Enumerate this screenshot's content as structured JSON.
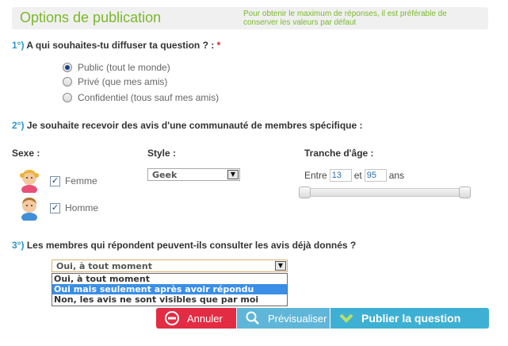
{
  "header": {
    "title": "Options de publication",
    "hint": "Pour obtenir le maximum de réponses, il est préférable de conserver les valeurs par défaut"
  },
  "q1": {
    "num": "1°)",
    "text": "A qui souhaites-tu diffuser ta question ? :",
    "required": "*",
    "options": [
      {
        "label": "Public (tout le monde)",
        "selected": true
      },
      {
        "label": "Privé (que mes amis)",
        "selected": false
      },
      {
        "label": "Confidentiel (tous sauf mes amis)",
        "selected": false
      }
    ]
  },
  "q2": {
    "num": "2°)",
    "text": "Je souhaite recevoir des avis d'une communauté de membres spécifique :",
    "sexe_label": "Sexe :",
    "style_label": "Style :",
    "age_label": "Tranche d'âge :",
    "femme": {
      "label": "Femme",
      "checked": true,
      "mark": "✓"
    },
    "homme": {
      "label": "Homme",
      "checked": true,
      "mark": "✓"
    },
    "style_value": "Geek",
    "age": {
      "prefix": "Entre",
      "min": "13",
      "middle": "et",
      "max": "95",
      "suffix": "ans"
    }
  },
  "q3": {
    "num": "3°)",
    "text": "Les membres qui répondent peuvent-ils consulter les avis déjà donnés ?",
    "select_value": "Oui, à tout moment",
    "options": [
      "Oui, à tout moment",
      "Oui mais seulement après avoir répondu",
      "Non, les avis ne sont visibles que par moi"
    ],
    "highlighted_index": 1
  },
  "buttons": {
    "cancel": "Annuler",
    "preview": "Prévisualiser",
    "publish": "Publier la question"
  },
  "colors": {
    "accent_green": "#7ab829",
    "accent_blue": "#2a97c9",
    "cancel_red": "#e32c44",
    "publish_blue": "#3eb0d3",
    "highlight": "#3a8ee6"
  },
  "icons": {
    "select_arrow": "▼"
  }
}
